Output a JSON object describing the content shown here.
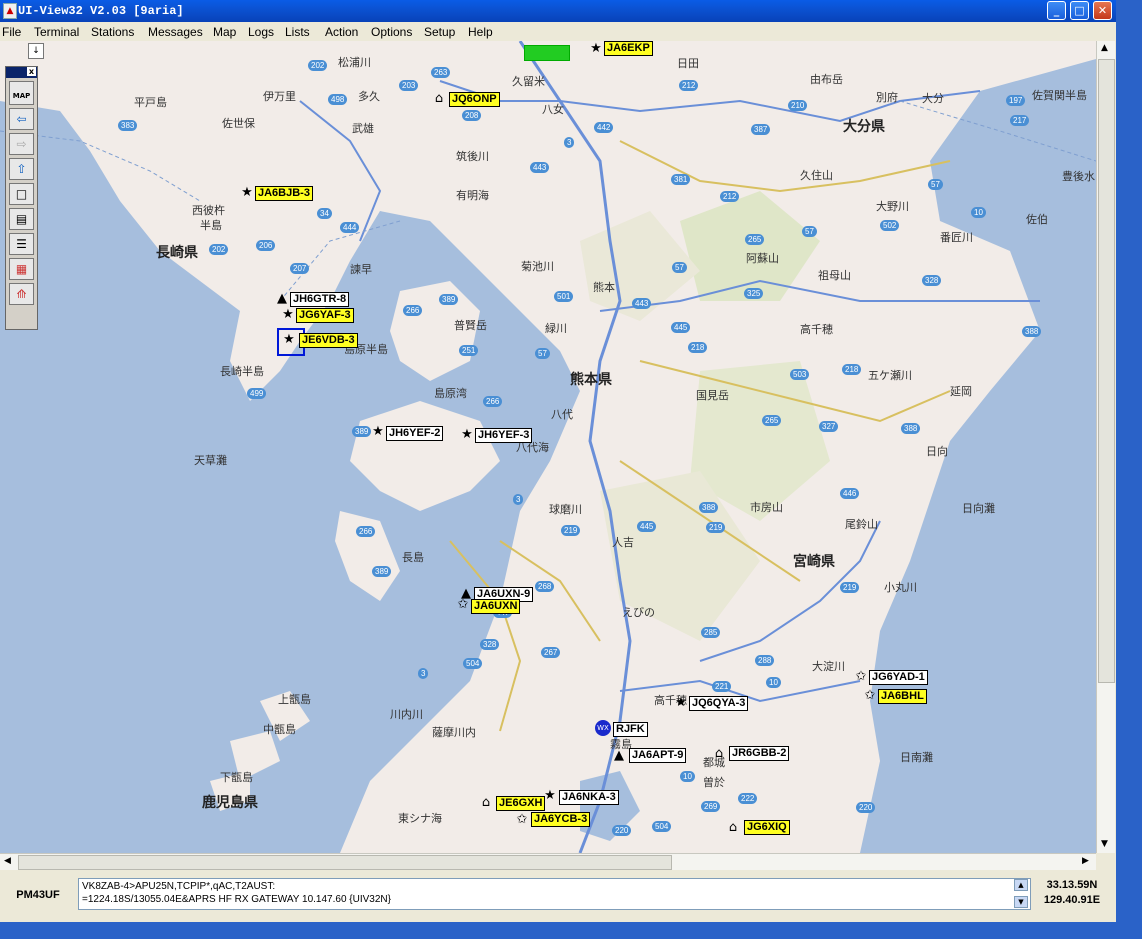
{
  "window": {
    "title": "UI-View32  V2.03  [9aria]",
    "buttons": [
      "_",
      "□",
      "✕"
    ]
  },
  "menu": [
    "File",
    "Terminal",
    "Stations",
    "Messages",
    "Map",
    "Logs",
    "Lists",
    "Action",
    "Options",
    "Setup",
    "Help"
  ],
  "toolbar": {
    "map_label": "MAP",
    "close": "x",
    "buttons": [
      "map-icon",
      "back-arrow-icon",
      "forward-arrow-icon",
      "up-arrow-icon",
      "window-icon",
      "computer-icon",
      "document-icon",
      "calendar-icon",
      "tower-icon"
    ]
  },
  "map": {
    "places": [
      "松浦川",
      "平戸島",
      "伊万里",
      "多久",
      "久留米",
      "日田",
      "由布岳",
      "別府",
      "大分",
      "佐賀関半島",
      "佐世保",
      "武雄",
      "八女",
      "筑後川",
      "大分県",
      "有明海",
      "久住山",
      "豊後水",
      "西彼杵",
      "半島",
      "長崎県",
      "大野川",
      "番匠川",
      "佐伯",
      "諫早",
      "菊池川",
      "熊本",
      "阿蘇山",
      "祖母山",
      "普賢岳",
      "緑川",
      "高千穂",
      "島原半島",
      "長崎半島",
      "熊本県",
      "五ケ瀬川",
      "島原湾",
      "国見岳",
      "延岡",
      "八代",
      "八代海",
      "天草灘",
      "日向",
      "球磨川",
      "市房山",
      "尾鈴山",
      "日向灘",
      "人吉",
      "宮崎県",
      "長島",
      "えびの",
      "小丸川",
      "上甑島",
      "高千穂",
      "大淀川",
      "中甑島",
      "川内川",
      "薩摩川内",
      "霧島",
      "都城",
      "日南灘",
      "下甑島",
      "鹿児島県",
      "東シナ海",
      "曽於"
    ],
    "routes": [
      "202",
      "263",
      "203",
      "498",
      "208",
      "212",
      "210",
      "197",
      "383",
      "387",
      "442",
      "217",
      "3",
      "443",
      "381",
      "57",
      "212",
      "34",
      "444",
      "206",
      "202",
      "207",
      "265",
      "57",
      "502",
      "10",
      "57",
      "501",
      "389",
      "443",
      "325",
      "328",
      "445",
      "266",
      "218",
      "388",
      "251",
      "57",
      "503",
      "218",
      "499",
      "266",
      "265",
      "327",
      "388",
      "389",
      "3",
      "219",
      "445",
      "388",
      "219",
      "446",
      "266",
      "389",
      "268",
      "447",
      "219",
      "328",
      "267",
      "285",
      "504",
      "3",
      "288",
      "221",
      "10",
      "10",
      "269",
      "222",
      "220",
      "504",
      "220"
    ],
    "stations": [
      {
        "call": "JA6EKP",
        "style": "yellow",
        "icon": "U"
      },
      {
        "call": "JQ6ONP",
        "style": "yellow",
        "icon": "house"
      },
      {
        "call": "JA6BJB-3",
        "style": "yellow",
        "icon": "U"
      },
      {
        "call": "JH6GTR-8",
        "style": "white",
        "icon": "car"
      },
      {
        "call": "JG6YAF-3",
        "style": "yellow",
        "icon": "U"
      },
      {
        "call": "JE6VDB-3",
        "style": "yellow",
        "icon": "U"
      },
      {
        "call": "JH6YEF-2",
        "style": "white",
        "icon": "U"
      },
      {
        "call": "JH6YEF-3",
        "style": "white",
        "icon": "U"
      },
      {
        "call": "JA6UXN-9",
        "style": "white",
        "icon": "car"
      },
      {
        "call": "JA6UXN",
        "style": "yellow",
        "icon": "star"
      },
      {
        "call": "JG6YAD-1",
        "style": "white",
        "icon": "star"
      },
      {
        "call": "JA6BHL",
        "style": "yellow",
        "icon": "star"
      },
      {
        "call": "JQ6QYA-3",
        "style": "white",
        "icon": "U"
      },
      {
        "call": "RJFK",
        "style": "white",
        "icon": "wx"
      },
      {
        "call": "JR6GBB-2",
        "style": "white",
        "icon": "house"
      },
      {
        "call": "JA6APT-9",
        "style": "white",
        "icon": "car"
      },
      {
        "call": "JA6NKA-3",
        "style": "white",
        "icon": "U"
      },
      {
        "call": "JE6GXH",
        "style": "yellow",
        "icon": "house"
      },
      {
        "call": "JA6YCB-3",
        "style": "yellow",
        "icon": "star"
      },
      {
        "call": "JG6XIQ",
        "style": "yellow",
        "icon": "house"
      }
    ]
  },
  "status": {
    "grid": "PM43UF",
    "message_line1": "VK8ZAB-4>APU25N,TCPIP*,qAC,T2AUST:",
    "message_line2": "=1224.18S/13055.04E&APRS HF RX GATEWAY 10.147.60 {UIV32N}",
    "lat": "33.13.59N",
    "lon": "129.40.91E"
  },
  "colors": {
    "sea": "#a6bedd",
    "land": "#f2ece8",
    "title": "#0b52d2",
    "highlight": "#ffff22"
  }
}
